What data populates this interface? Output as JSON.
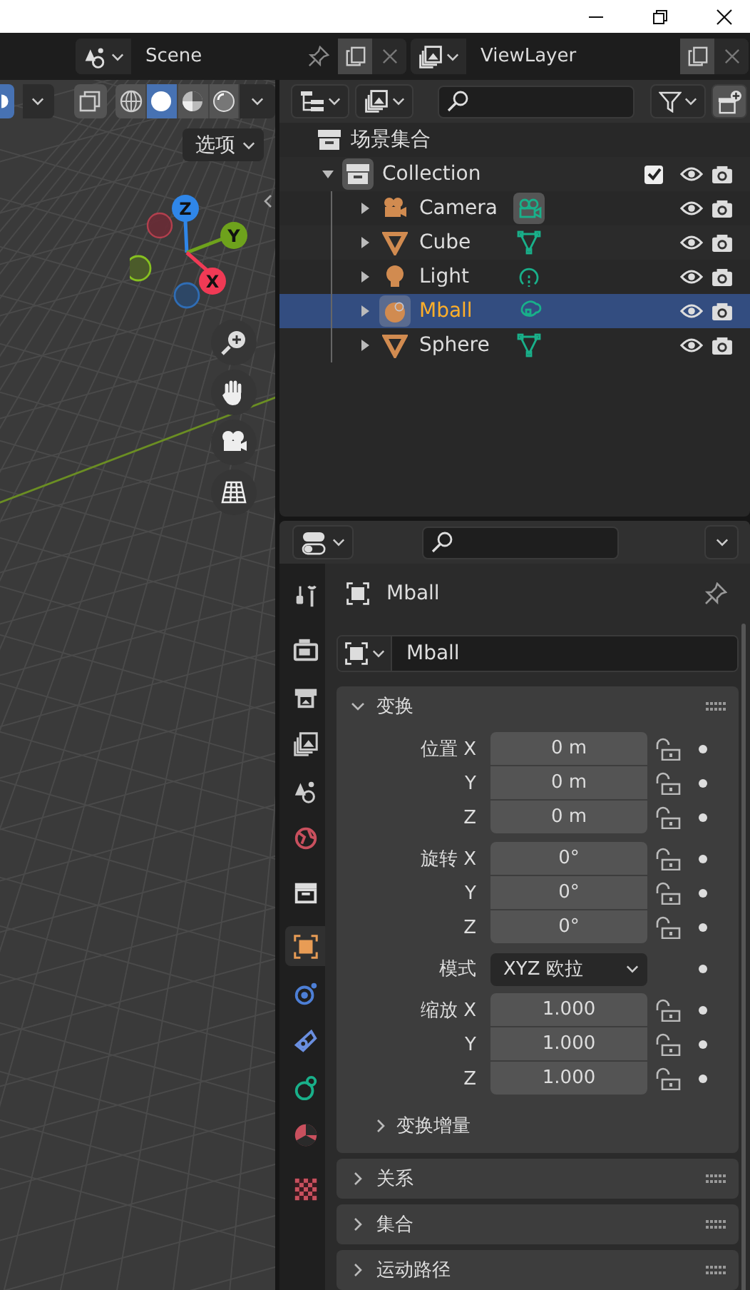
{
  "header": {
    "scene": {
      "name": "Scene"
    },
    "view_layer": {
      "name": "ViewLayer"
    }
  },
  "viewport": {
    "shading_modes": [
      {
        "kind": "wire",
        "selected": false
      },
      {
        "kind": "solid",
        "selected": true
      },
      {
        "kind": "material",
        "selected": false
      },
      {
        "kind": "rendered",
        "selected": false
      }
    ],
    "options_label": "选项",
    "gizmo_axes": [
      {
        "label": "Z",
        "color": "#2f86e8"
      },
      {
        "label": "Y",
        "color": "#6ea21c"
      },
      {
        "label": "X",
        "color": "#f03a55"
      }
    ]
  },
  "outliner": {
    "root": "场景集合",
    "tree": [
      {
        "name": "Collection",
        "expanded": true,
        "checked": true,
        "children": [
          {
            "name": "Camera",
            "kind": "camera",
            "expanded": false,
            "selected": false,
            "data_active": true
          },
          {
            "name": "Cube",
            "kind": "mesh",
            "expanded": false,
            "selected": false,
            "data_active": false
          },
          {
            "name": "Light",
            "kind": "light",
            "expanded": false,
            "selected": false,
            "data_active": false
          },
          {
            "name": "Mball",
            "kind": "metaball",
            "expanded": false,
            "selected": true,
            "data_active": false
          },
          {
            "name": "Sphere",
            "kind": "mesh",
            "expanded": false,
            "selected": false,
            "data_active": false
          }
        ]
      }
    ]
  },
  "properties": {
    "tabs": [
      {
        "kind": "tool",
        "selected": false
      },
      {
        "kind": "render",
        "selected": false
      },
      {
        "kind": "output",
        "selected": false
      },
      {
        "kind": "view_layer",
        "selected": false
      },
      {
        "kind": "scene",
        "selected": false
      },
      {
        "kind": "world",
        "selected": false
      },
      {
        "kind": "collection",
        "selected": false
      },
      {
        "kind": "object",
        "selected": true
      },
      {
        "kind": "physics",
        "selected": false
      },
      {
        "kind": "constraints",
        "selected": false
      },
      {
        "kind": "data",
        "selected": false
      },
      {
        "kind": "material",
        "selected": false
      },
      {
        "kind": "texture",
        "selected": false
      }
    ],
    "object_name": "Mball",
    "data_name": "Mball",
    "transform": {
      "title": "变换",
      "expanded": true,
      "groups": [
        {
          "rows": [
            {
              "kind": "number",
              "label": "位置 X",
              "value": "0 m",
              "locked": false
            },
            {
              "kind": "number",
              "label": "Y",
              "value": "0 m",
              "locked": false
            },
            {
              "kind": "number",
              "label": "Z",
              "value": "0 m",
              "locked": false
            }
          ]
        },
        {
          "rows": [
            {
              "kind": "number",
              "label": "旋转 X",
              "value": "0°",
              "locked": false
            },
            {
              "kind": "number",
              "label": "Y",
              "value": "0°",
              "locked": false
            },
            {
              "kind": "number",
              "label": "Z",
              "value": "0°",
              "locked": false
            }
          ]
        },
        {
          "rows": [
            {
              "kind": "dropdown",
              "label": "模式",
              "value": "XYZ 欧拉"
            }
          ]
        },
        {
          "rows": [
            {
              "kind": "number",
              "label": "缩放 X",
              "value": "1.000",
              "locked": false
            },
            {
              "kind": "number",
              "label": "Y",
              "value": "1.000",
              "locked": false
            },
            {
              "kind": "number",
              "label": "Z",
              "value": "1.000",
              "locked": false
            }
          ]
        }
      ],
      "subpanel": {
        "title": "变换增量",
        "expanded": false
      }
    },
    "panels": [
      {
        "title": "关系",
        "expanded": false
      },
      {
        "title": "集合",
        "expanded": false
      },
      {
        "title": "运动路径",
        "expanded": false
      }
    ]
  }
}
